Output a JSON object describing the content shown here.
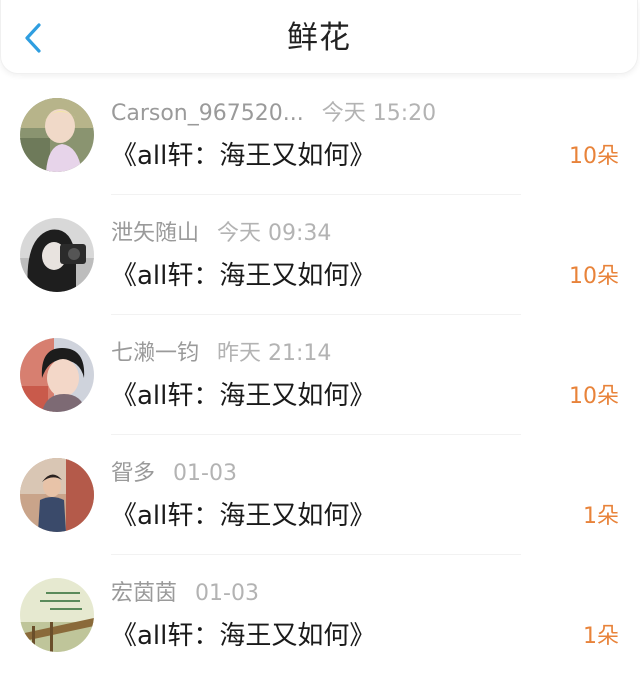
{
  "header": {
    "title": "鲜花",
    "back_icon": "chevron-left-icon",
    "accent_color": "#2f9ee0"
  },
  "count_color": "#e8833a",
  "records": [
    {
      "name": "Carson_967520...",
      "time": "今天 15:20",
      "book": "《all轩：海王又如何》",
      "count": "10朵"
    },
    {
      "name": "泄矢随山",
      "time": "今天 09:34",
      "book": "《all轩：海王又如何》",
      "count": "10朵"
    },
    {
      "name": "七濑一钧",
      "time": "昨天 21:14",
      "book": "《all轩：海王又如何》",
      "count": "10朵"
    },
    {
      "name": "眢多",
      "time": "01-03",
      "book": "《all轩：海王又如何》",
      "count": "1朵"
    },
    {
      "name": "宏茵茵",
      "time": "01-03",
      "book": "《all轩：海王又如何》",
      "count": "1朵"
    }
  ]
}
